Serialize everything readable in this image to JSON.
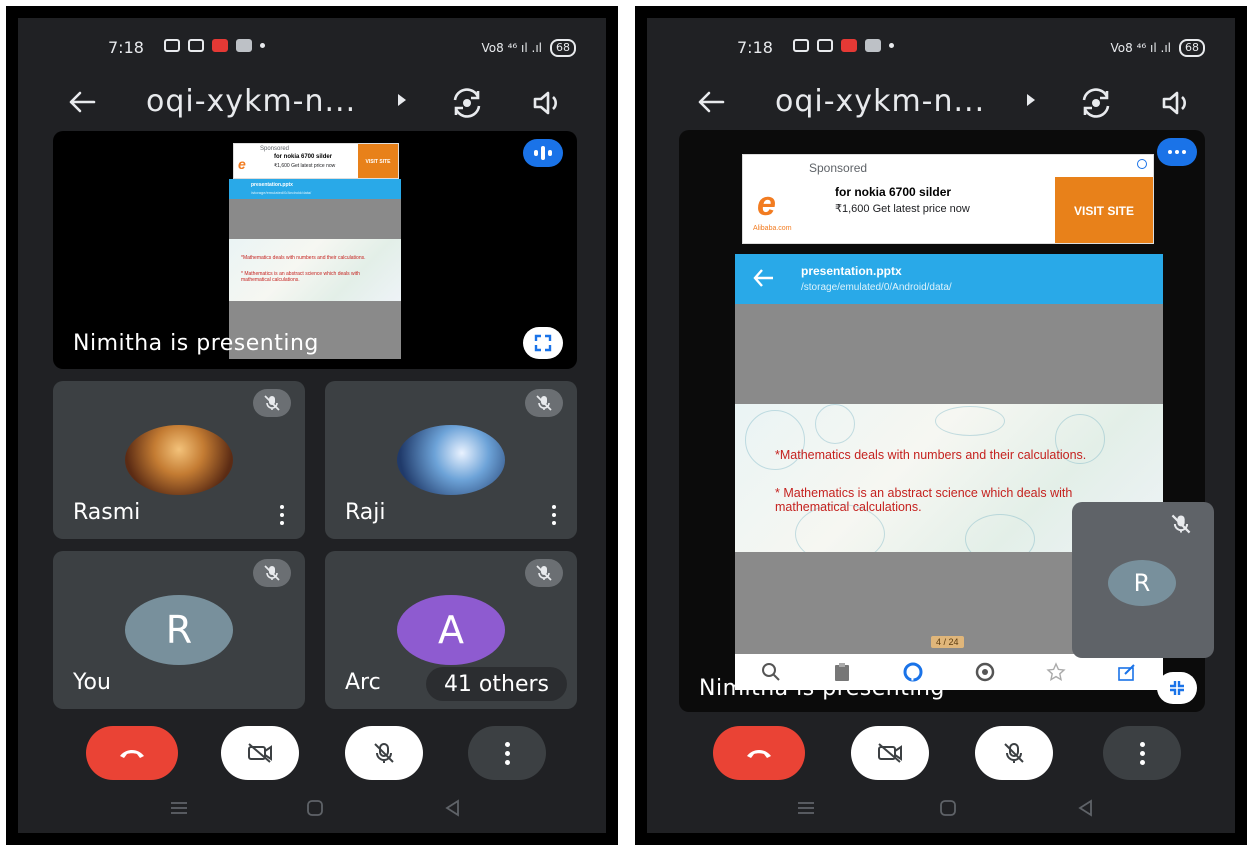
{
  "left_screen": {
    "status": {
      "time": "7:18",
      "network": "Vo8 ⁴⁶ ıl .ıl",
      "battery": "68"
    },
    "header": {
      "title": "oqi-xykm-n..."
    },
    "stage": {
      "presenting_text": "Nimitha is presenting",
      "ad": {
        "sponsored": "Sponsored",
        "title": "for nokia 6700 silder",
        "price": "₹1,600 Get latest price now",
        "cta": "VISIT SITE"
      },
      "presentation": {
        "file": "presentation.pptx",
        "path": "/storage/emulated/0/Android/data/",
        "line1": "*Mathematics deals with numbers and their calculations.",
        "line2": "* Mathematics is an abstract science which deals with  mathematical calculations."
      }
    },
    "tiles": [
      {
        "name": "Rasmi"
      },
      {
        "name": "Raji"
      },
      {
        "name": "You",
        "initial": "R",
        "avatar_color": "#78909c"
      },
      {
        "name": "Arc",
        "initial": "A",
        "avatar_color": "#8e5bd0"
      }
    ],
    "others_label": "41 others"
  },
  "right_screen": {
    "status": {
      "time": "7:18",
      "network": "Vo8 ⁴⁶ ıl .ıl",
      "battery": "68"
    },
    "header": {
      "title": "oqi-xykm-n..."
    },
    "stage": {
      "presenting_text": "Nimitha is presenting",
      "ad": {
        "sponsored": "Sponsored",
        "title": "for nokia 6700 silder",
        "price": "₹1,600 Get latest price now",
        "cta": "VISIT SITE",
        "logo": "Alibaba.com"
      },
      "presentation": {
        "file": "presentation.pptx",
        "path": "/storage/emulated/0/Android/data/",
        "line1": "*Mathematics deals with numbers and their calculations.",
        "line2": "* Mathematics is an abstract science which deals with  mathematical calculations.",
        "page": "4 / 24"
      }
    },
    "self_view": {
      "initial": "R"
    }
  },
  "colors": {
    "end_call": "#ea4335",
    "accent": "#1a73e8",
    "tile_bg": "#3c4043",
    "screen_bg": "#202124"
  }
}
